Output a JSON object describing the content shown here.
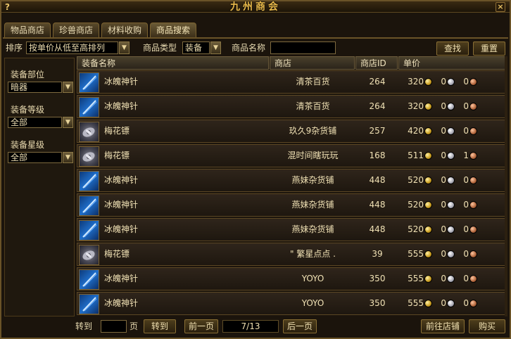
{
  "window": {
    "title": "九州商会",
    "help_label": "?",
    "close_label": "×"
  },
  "tabs": [
    {
      "label": "物品商店",
      "active": false
    },
    {
      "label": "珍兽商店",
      "active": false
    },
    {
      "label": "材料收购",
      "active": false
    },
    {
      "label": "商品搜索",
      "active": true
    }
  ],
  "filter": {
    "sort_label": "排序",
    "sort_value": "按单价从低至高排列",
    "type_label": "商品类型",
    "type_value": "装备",
    "name_label": "商品名称",
    "name_value": "",
    "search_button": "查找",
    "reset_button": "重置"
  },
  "left_panel": {
    "slot_label": "装备部位",
    "slot_value": "暗器",
    "level_label": "装备等级",
    "level_value": "全部",
    "star_label": "装备星级",
    "star_value": "全部"
  },
  "table": {
    "columns": [
      "装备名称",
      "商店",
      "商店ID",
      "单价"
    ],
    "rows": [
      {
        "icon": "needle-icon",
        "name": "冰魄神针",
        "shop": "清茶百货",
        "shop_id": "264",
        "gold": "320",
        "silver": "0",
        "copper": "0"
      },
      {
        "icon": "needle-icon",
        "name": "冰魄神针",
        "shop": "清茶百货",
        "shop_id": "264",
        "gold": "320",
        "silver": "0",
        "copper": "0"
      },
      {
        "icon": "dart-icon",
        "name": "梅花镖",
        "shop": "玖久9杂货铺",
        "shop_id": "257",
        "gold": "420",
        "silver": "0",
        "copper": "0"
      },
      {
        "icon": "dart-icon",
        "name": "梅花镖",
        "shop": "混时间瞎玩玩",
        "shop_id": "168",
        "gold": "511",
        "silver": "0",
        "copper": "1"
      },
      {
        "icon": "needle-icon",
        "name": "冰魄神针",
        "shop": "燕妹杂货铺",
        "shop_id": "448",
        "gold": "520",
        "silver": "0",
        "copper": "0"
      },
      {
        "icon": "needle-icon",
        "name": "冰魄神针",
        "shop": "燕妹杂货铺",
        "shop_id": "448",
        "gold": "520",
        "silver": "0",
        "copper": "0"
      },
      {
        "icon": "needle-icon",
        "name": "冰魄神针",
        "shop": "燕妹杂货铺",
        "shop_id": "448",
        "gold": "520",
        "silver": "0",
        "copper": "0"
      },
      {
        "icon": "dart-icon",
        "name": "梅花镖",
        "shop": "\" 繁星点点 .",
        "shop_id": "39",
        "gold": "555",
        "silver": "0",
        "copper": "0"
      },
      {
        "icon": "needle-icon",
        "name": "冰魄神针",
        "shop": "YOYO",
        "shop_id": "350",
        "gold": "555",
        "silver": "0",
        "copper": "0"
      },
      {
        "icon": "needle-icon",
        "name": "冰魄神针",
        "shop": "YOYO",
        "shop_id": "350",
        "gold": "555",
        "silver": "0",
        "copper": "0"
      }
    ]
  },
  "pagination": {
    "goto_label": "转到",
    "page_input": "",
    "page_unit": "页",
    "goto_button": "转到",
    "prev_button": "前一页",
    "page_info": "7/13",
    "next_button": "后一页"
  },
  "actions": {
    "visit_shop": "前往店铺",
    "buy": "购买"
  },
  "colors": {
    "gold_text": "#e7b84a",
    "border": "#6a5328",
    "background": "#1b140c"
  }
}
